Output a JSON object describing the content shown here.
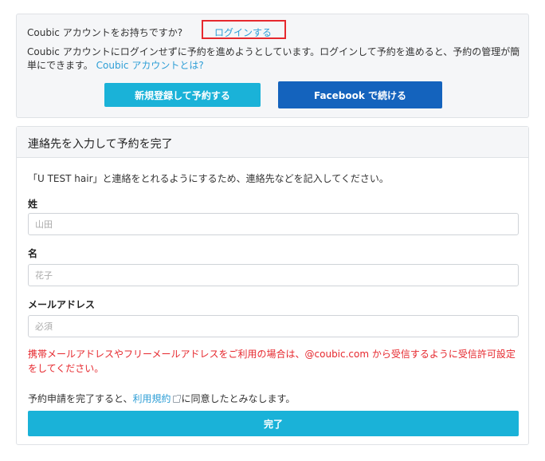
{
  "login_panel": {
    "question_prefix": "Coubic アカウントをお持ちですか?",
    "login_link": "ログインする",
    "description": "Coubic アカウントにログインせずに予約を進めようとしています。ログインして予約を進めると、予約の管理が簡単にできます。",
    "about_account_link": "Coubic アカウントとは?",
    "register_button": "新規登録して予約する",
    "facebook_button": "Facebook で続ける"
  },
  "contact_form": {
    "title": "連絡先を入力して予約を完了",
    "intro": "「U TEST hair」と連絡をとれるようにするため、連絡先などを記入してください。",
    "last_name": {
      "label": "姓",
      "placeholder": "山田"
    },
    "first_name": {
      "label": "名",
      "placeholder": "花子"
    },
    "email": {
      "label": "メールアドレス",
      "placeholder": "必須"
    },
    "warning": "携帯メールアドレスやフリーメールアドレスをご利用の場合は、@coubic.com から受信するように受信許可設定をしてください。",
    "terms_prefix": "予約申請を完了すると、",
    "terms_link": "利用規約",
    "terms_suffix": "に同意したとみなします。",
    "submit_button": "完了"
  },
  "colors": {
    "accent_cyan": "#1ab2d8",
    "facebook_blue": "#1463bd",
    "link_blue": "#2d9ed6",
    "warning_red": "#e6282e",
    "highlight_box": "#e6282e"
  },
  "icons": [
    "external-link-icon"
  ]
}
